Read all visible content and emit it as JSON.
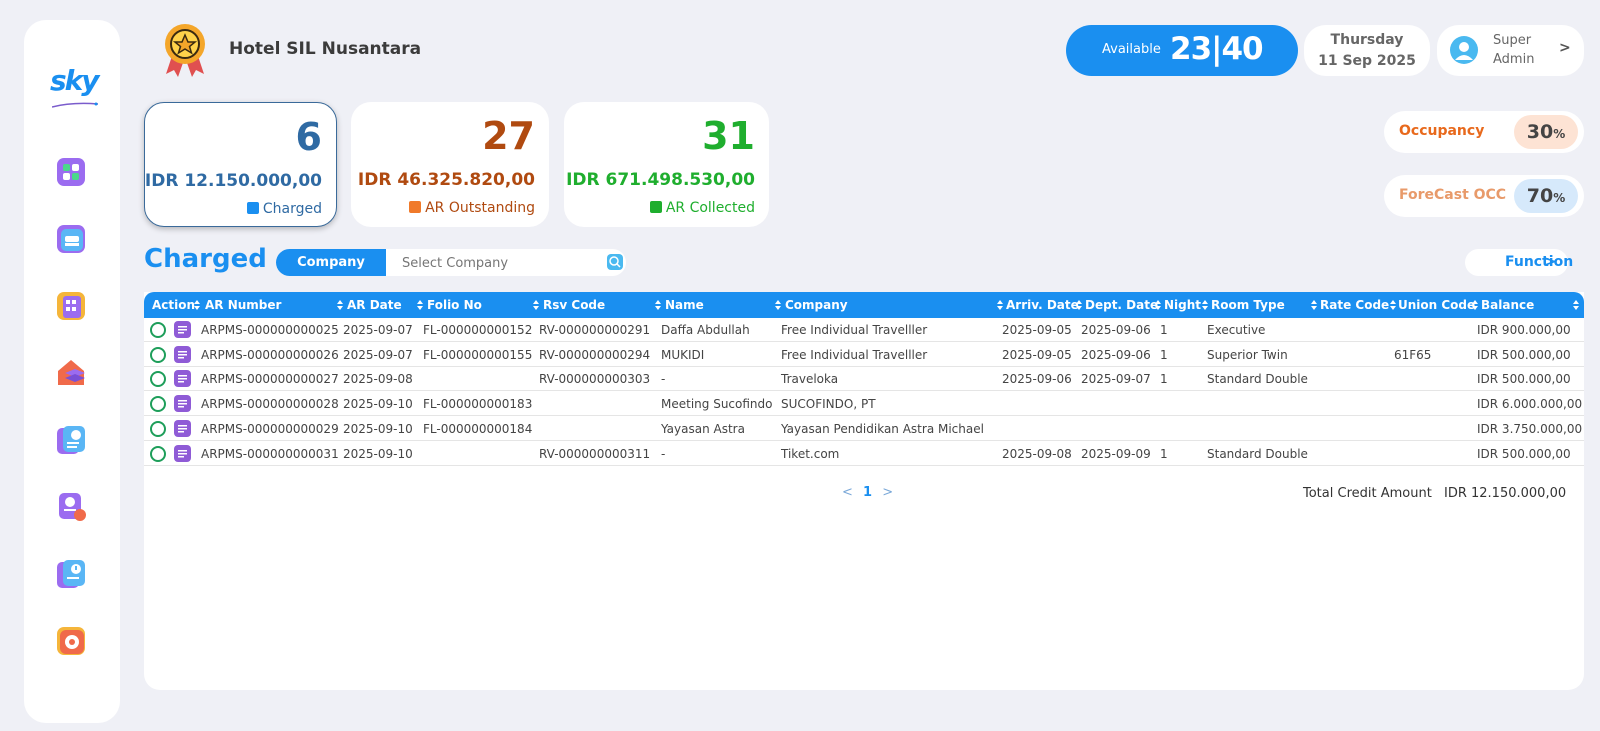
{
  "brand": {
    "logo_text": "sky"
  },
  "header": {
    "hotel_name": "Hotel SIL Nusantara",
    "available_label": "Available",
    "available_value": "23|40",
    "day": "Thursday",
    "date": "11 Sep 2025",
    "user_line1": "Super",
    "user_line2": "Admin"
  },
  "cards": [
    {
      "count": "6",
      "amount": "IDR 12.150.000,00",
      "label": "Charged",
      "color": "#2f6aa3"
    },
    {
      "count": "27",
      "amount": "IDR 46.325.820,00",
      "label": "AR Outstanding",
      "color": "#b04a10"
    },
    {
      "count": "31",
      "amount": "IDR 671.498.530,00",
      "label": "AR Collected",
      "color": "#1fae2e"
    }
  ],
  "occupancy": {
    "label": "Occupancy",
    "value": "30",
    "unit": "%"
  },
  "forecast": {
    "label": "ForeCast OCC",
    "value": "70",
    "unit": "%"
  },
  "section": {
    "title": "Charged",
    "filter_tab": "Company",
    "filter_placeholder": "Select Company",
    "function_label": "Function"
  },
  "columns": [
    "Action",
    "AR Number",
    "AR Date",
    "Folio No",
    "Rsv Code",
    "Name",
    "Company",
    "Arriv. Date",
    "Dept. Date",
    "Night",
    "Room Type",
    "Rate Code",
    "Union Code",
    "Balance"
  ],
  "rows": [
    {
      "ar": "ARPMS-000000000025",
      "date": "2025-09-07",
      "folio": "FL-000000000152",
      "rsv": "RV-000000000291",
      "name": "Daffa Abdullah",
      "company": "Free Individual Travelller",
      "arr": "2025-09-05",
      "dep": "2025-09-06",
      "night": "1",
      "room": "Executive",
      "rate": "",
      "union": "",
      "bal": "IDR 900.000,00"
    },
    {
      "ar": "ARPMS-000000000026",
      "date": "2025-09-07",
      "folio": "FL-000000000155",
      "rsv": "RV-000000000294",
      "name": "MUKIDI",
      "company": "Free Individual Travelller",
      "arr": "2025-09-05",
      "dep": "2025-09-06",
      "night": "1",
      "room": "Superior Twin",
      "rate": "",
      "union": "61F65",
      "bal": "IDR 500.000,00"
    },
    {
      "ar": "ARPMS-000000000027",
      "date": "2025-09-08",
      "folio": "",
      "rsv": "RV-000000000303",
      "name": "-",
      "company": "Traveloka",
      "arr": "2025-09-06",
      "dep": "2025-09-07",
      "night": "1",
      "room": "Standard Double",
      "rate": "",
      "union": "",
      "bal": "IDR 500.000,00"
    },
    {
      "ar": "ARPMS-000000000028",
      "date": "2025-09-10",
      "folio": "FL-000000000183",
      "rsv": "",
      "name": "Meeting Sucofindo",
      "company": "SUCOFINDO, PT",
      "arr": "",
      "dep": "",
      "night": "",
      "room": "",
      "rate": "",
      "union": "",
      "bal": "IDR 6.000.000,00"
    },
    {
      "ar": "ARPMS-000000000029",
      "date": "2025-09-10",
      "folio": "FL-000000000184",
      "rsv": "",
      "name": "Yayasan Astra",
      "company": "Yayasan Pendidikan Astra Michael",
      "arr": "",
      "dep": "",
      "night": "",
      "room": "",
      "rate": "",
      "union": "",
      "bal": "IDR 3.750.000,00"
    },
    {
      "ar": "ARPMS-000000000031",
      "date": "2025-09-10",
      "folio": "",
      "rsv": "RV-000000000311",
      "name": "-",
      "company": "Tiket.com",
      "arr": "2025-09-08",
      "dep": "2025-09-09",
      "night": "1",
      "room": "Standard Double",
      "rate": "",
      "union": "",
      "bal": "IDR 500.000,00"
    }
  ],
  "pagination": {
    "current": "1"
  },
  "total": {
    "label": "Total Credit Amount",
    "value": "IDR 12.150.000,00"
  },
  "icons": {
    "nav": [
      "dashboard-icon",
      "room-icon",
      "building-icon",
      "layers-icon",
      "invoice-icon",
      "report-icon",
      "alert-doc-icon",
      "settings-icon"
    ]
  }
}
